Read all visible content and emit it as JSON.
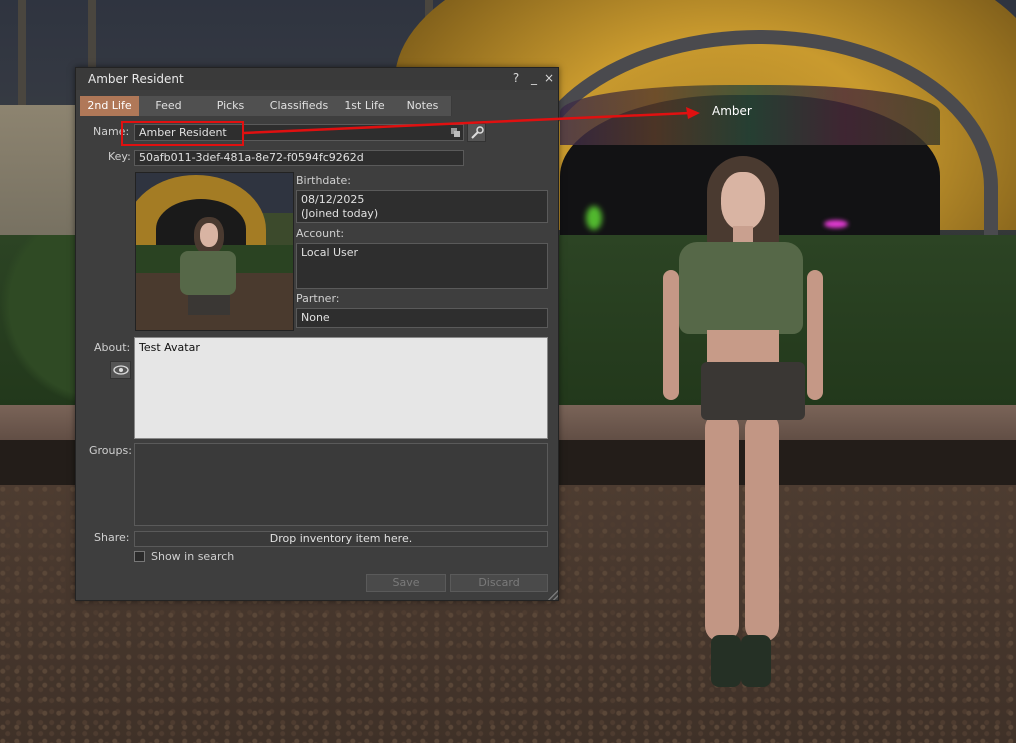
{
  "window": {
    "title": "Amber Resident",
    "help_glyph": "?",
    "minimize_glyph": "_",
    "close_glyph": "×"
  },
  "tabs": [
    {
      "label": "2nd Life",
      "active": true
    },
    {
      "label": "Feed"
    },
    {
      "label": "Picks"
    },
    {
      "label": "Classifieds"
    },
    {
      "label": "1st Life"
    },
    {
      "label": "Notes"
    }
  ],
  "profile": {
    "name_label": "Name:",
    "name_value": "Amber Resident",
    "key_label": "Key:",
    "key_value": "50afb011-3def-481a-8e72-f0594fc9262d",
    "birthdate_label": "Birthdate:",
    "birthdate_value": "08/12/2025",
    "birthdate_note": "(Joined today)",
    "account_label": "Account:",
    "account_value": "Local User",
    "partner_label": "Partner:",
    "partner_value": "None",
    "about_label": "About:",
    "about_value": "Test Avatar",
    "groups_label": "Groups:",
    "share_label": "Share:",
    "share_dropzone": "Drop inventory item here.",
    "show_in_search_label": "Show in search",
    "show_in_search_checked": false,
    "save_label": "Save",
    "discard_label": "Discard"
  },
  "scene": {
    "nametag": "Amber"
  },
  "colors": {
    "active_tab": "#b07858",
    "annotation": "#e01010"
  },
  "icons": [
    "copy-icon",
    "wrench-icon",
    "eye-icon"
  ]
}
